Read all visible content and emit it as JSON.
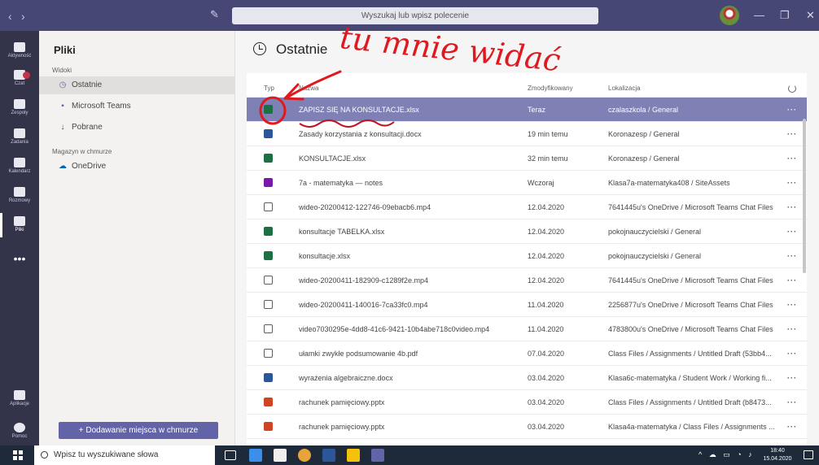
{
  "titlebar": {
    "search_placeholder": "Wyszukaj lub wpisz polecenie",
    "nav_back": "‹",
    "nav_forward": "›",
    "minimize": "—",
    "maximize": "❐",
    "close": "✕"
  },
  "rail": {
    "items": [
      {
        "label": "Aktywność",
        "icon": "bell-icon"
      },
      {
        "label": "Czat",
        "icon": "chat-icon"
      },
      {
        "label": "Zespoły",
        "icon": "teams-icon"
      },
      {
        "label": "Zadania",
        "icon": "assignments-icon"
      },
      {
        "label": "Kalendarz",
        "icon": "calendar-icon"
      },
      {
        "label": "Rozmowy",
        "icon": "phone-icon"
      },
      {
        "label": "Pliki",
        "icon": "files-icon"
      }
    ],
    "more": "•••",
    "apps": "Aplikacje",
    "help": "Pomoc"
  },
  "leftpanel": {
    "title": "Pliki",
    "views_label": "Widoki",
    "views": [
      {
        "label": "Ostatnie",
        "icon": "clock-icon"
      },
      {
        "label": "Microsoft Teams",
        "icon": "teams-icon"
      },
      {
        "label": "Pobrane",
        "icon": "download-icon"
      }
    ],
    "storage_label": "Magazyn w chmurze",
    "storage": [
      {
        "label": "OneDrive",
        "icon": "onedrive-icon"
      }
    ],
    "add_cloud": "+   Dodawanie miejsca w chmurze"
  },
  "main": {
    "title": "Ostatnie",
    "columns": {
      "type": "Typ",
      "name": "Nazwa",
      "modified": "Zmodyfikowany",
      "location": "Lokalizacja"
    },
    "rows": [
      {
        "type": "excel",
        "name": "ZAPISZ SIĘ NA KONSULTACJE.xlsx",
        "modified": "Teraz",
        "location": "czalaszkola / General",
        "selected": true
      },
      {
        "type": "word",
        "name": "Zasady korzystania z konsultacji.docx",
        "modified": "19 min temu",
        "location": "Koronazesp / General"
      },
      {
        "type": "excel",
        "name": "KONSULTACJE.xlsx",
        "modified": "32 min temu",
        "location": "Koronazesp / General"
      },
      {
        "type": "onenote",
        "name": "7a - matematyka — notes",
        "modified": "Wczoraj",
        "location": "Klasa7a-matematyka408 / SiteAssets"
      },
      {
        "type": "video",
        "name": "wideo-20200412-122746-09ebacb6.mp4",
        "modified": "12.04.2020",
        "location": "7641445u's OneDrive / Microsoft Teams Chat Files"
      },
      {
        "type": "excel",
        "name": "konsultacje TABELKA.xlsx",
        "modified": "12.04.2020",
        "location": "pokojnauczycielski / General"
      },
      {
        "type": "excel",
        "name": "konsultacje.xlsx",
        "modified": "12.04.2020",
        "location": "pokojnauczycielski / General"
      },
      {
        "type": "video",
        "name": "wideo-20200411-182909-c1289f2e.mp4",
        "modified": "12.04.2020",
        "location": "7641445u's OneDrive / Microsoft Teams Chat Files"
      },
      {
        "type": "video",
        "name": "wideo-20200411-140016-7ca33fc0.mp4",
        "modified": "11.04.2020",
        "location": "2256877u's OneDrive / Microsoft Teams Chat Files"
      },
      {
        "type": "video",
        "name": "video7030295e-4dd8-41c6-9421-10b4abe718c0video.mp4",
        "modified": "11.04.2020",
        "location": "4783800u's OneDrive / Microsoft Teams Chat Files"
      },
      {
        "type": "pdf",
        "name": "ułamki zwykłe podsumowanie 4b.pdf",
        "modified": "07.04.2020",
        "location": "Class Files / Assignments / Untitled Draft (53bb4..."
      },
      {
        "type": "word",
        "name": "wyrażenia algebraiczne.docx",
        "modified": "03.04.2020",
        "location": "Klasa6c-matematyka / Student Work / Working fi..."
      },
      {
        "type": "pptx",
        "name": "rachunek pamięciowy.pptx",
        "modified": "03.04.2020",
        "location": "Class Files / Assignments / Untitled Draft (b8473..."
      },
      {
        "type": "pptx",
        "name": "rachunek pamięciowy.pptx",
        "modified": "03.04.2020",
        "location": "Klasa4a-matematyka / Class Files / Assignments ..."
      }
    ],
    "more_label": "···"
  },
  "annotation": {
    "text": "tu mnie widać",
    "color": "#e0191e"
  },
  "taskbar": {
    "search_placeholder": "Wpisz tu wyszukiwane słowa",
    "time": "18:40",
    "date": "15.04.2020"
  },
  "colors": {
    "titlebar": "#464775",
    "rail": "#33344a",
    "accent": "#6264a7",
    "selected_row": "#7f80b4"
  }
}
